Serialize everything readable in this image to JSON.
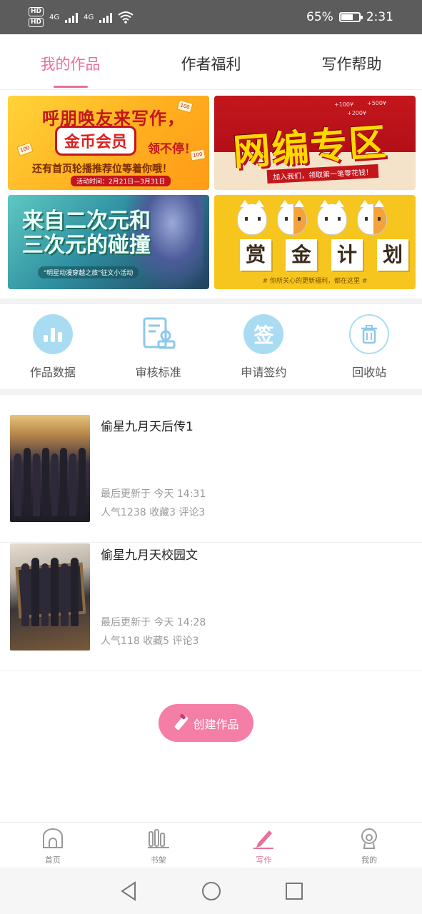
{
  "status_bar": {
    "hd_top": "HD",
    "hd_bottom": "HD",
    "net1": "4G",
    "net2": "4G",
    "battery": "65%",
    "battery_level": 0.65,
    "time": "2:31"
  },
  "tabs": [
    {
      "label": "我的作品",
      "active": true
    },
    {
      "label": "作者福利",
      "active": false
    },
    {
      "label": "写作帮助",
      "active": false
    }
  ],
  "banners": {
    "b1": {
      "line1": "呼朋唤友来写作，",
      "boxed": "金币会员",
      "boxed_side": "领不停！",
      "line3": "还有首页轮播推荐位等着你哦！",
      "date": "活动时间：2月21日—3月31日",
      "coin": "100"
    },
    "b2": {
      "title": "网编专区",
      "sub": "加入我们，领取第一笔零花钱！",
      "m1": "+100¥",
      "m2": "+500¥",
      "m3": "+200¥"
    },
    "b3": {
      "title_line1": "来自二次元和",
      "title_line2": "三次元的碰撞",
      "sub": "\"明星动漫穿越之旅\"征文小活动"
    },
    "b4": {
      "c1": "赏",
      "c2": "金",
      "c3": "计",
      "c4": "划",
      "sub": "# 你所关心的更新福利，都在这里 #"
    }
  },
  "shortcuts": [
    {
      "label": "作品数据",
      "icon": "bar-chart-icon"
    },
    {
      "label": "审核标准",
      "icon": "audit-document-icon"
    },
    {
      "label": "申请签约",
      "icon": "sign-icon",
      "glyph": "签"
    },
    {
      "label": "回收站",
      "icon": "trash-icon"
    }
  ],
  "works": [
    {
      "title": "偷星九月天后传1",
      "updated": "最后更新于 今天 14:31",
      "stats": "人气1238  收藏3  评论3"
    },
    {
      "title": "偷星九月天校园文",
      "updated": "最后更新于 今天 14:28",
      "stats": "人气118  收藏5  评论3"
    }
  ],
  "create_button": {
    "label": "创建作品"
  },
  "bottom_nav": [
    {
      "label": "首页",
      "icon": "home-icon"
    },
    {
      "label": "书架",
      "icon": "bookshelf-icon"
    },
    {
      "label": "写作",
      "icon": "pen-icon",
      "active": true
    },
    {
      "label": "我的",
      "icon": "profile-icon"
    }
  ],
  "colors": {
    "accent": "#e8709a",
    "button": "#f47ea6",
    "icon_blue": "#a9dcf3"
  }
}
